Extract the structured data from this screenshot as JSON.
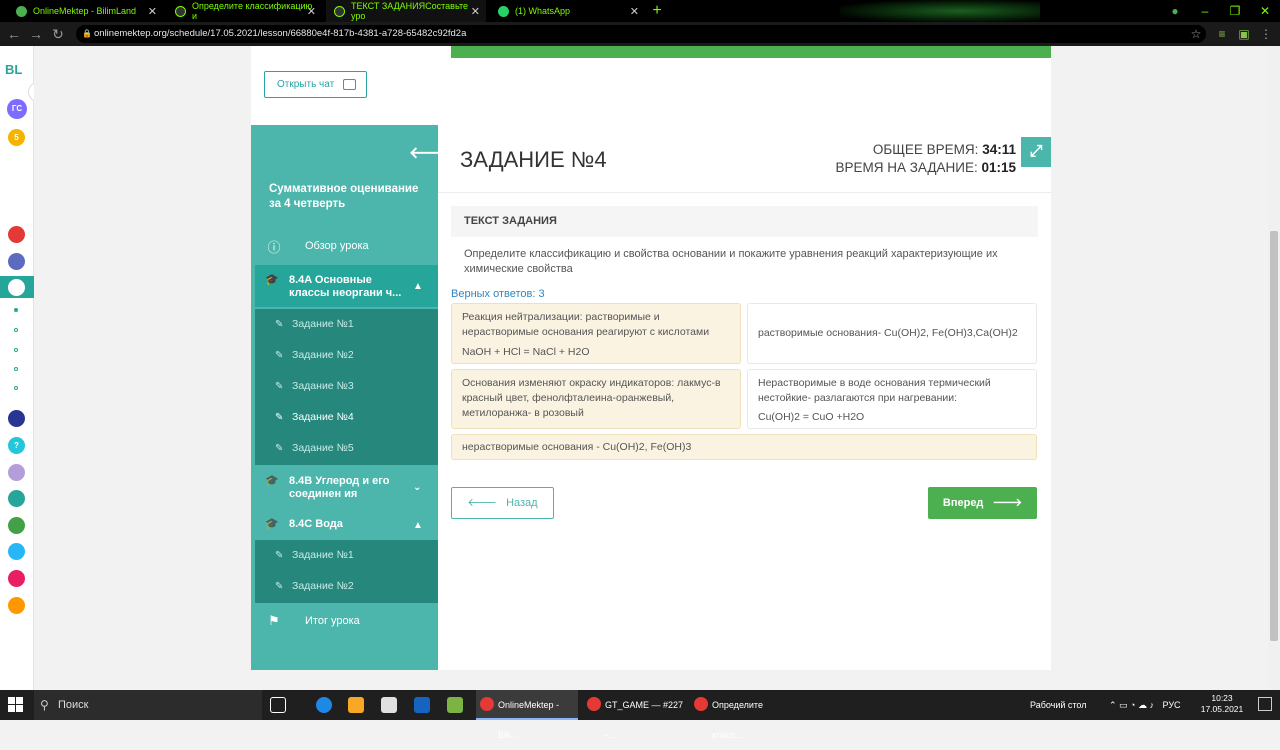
{
  "browser": {
    "tabs": [
      {
        "title": "OnlineMektep - BilimLand",
        "active": false,
        "icon_color": "#4caf50"
      },
      {
        "title": "Определите классификацию и",
        "active": false,
        "icon_color": "#333333"
      },
      {
        "title": "ТЕКСТ ЗАДАНИЯСоставьте уро",
        "active": true,
        "icon_color": "#333333"
      },
      {
        "title": "(1) WhatsApp",
        "active": false,
        "icon_color": "#25d366"
      }
    ],
    "url": "onlinemektep.org/schedule/17.05.2021/lesson/66880e4f-817b-4381-a728-65482c92fd2a"
  },
  "left_rail": {
    "logo": "BL",
    "avatar_initials": "ГС",
    "badge_count": "5"
  },
  "chat_button_label": "Открыть чат",
  "sidebar": {
    "course_title": "Суммативное оценивание за 4 четверть",
    "overview_label": "Обзор урока",
    "modules": [
      {
        "title": "8.4A Основные классы неоргани ч...",
        "expanded": true,
        "tasks": [
          "Задание №1",
          "Задание №2",
          "Задание №3",
          "Задание №4",
          "Задание №5"
        ],
        "current_task_index": 3
      },
      {
        "title": "8.4B Углерод и его соединен ия",
        "expanded": false
      },
      {
        "title": "8.4C Вода",
        "expanded": true,
        "tasks": [
          "Задание №1",
          "Задание №2"
        ]
      }
    ],
    "summary_label": "Итог урока"
  },
  "task": {
    "title": "ЗАДАНИЕ №4",
    "total_time_label": "ОБЩЕЕ ВРЕМЯ:",
    "total_time_value": "34:11",
    "task_time_label": "ВРЕМЯ НА ЗАДАНИЕ:",
    "task_time_value": "01:15",
    "section_header": "ТЕКСТ ЗАДАНИЯ",
    "question": "Определите классификацию и свойства основании и покажите уравнения реакций характеризующие их химические свойства",
    "correct_answers": "Верных ответов: 3",
    "answers": [
      {
        "line1": "Реакция нейтрализации: растворимые и нерастворимые основания реагируют с кислотами",
        "line2": "NaOH + HCl = NaCl + H2O"
      },
      {
        "line1": "растворимые основания- Cu(OH)2, Fe(OH)3,Ca(OH)2",
        "line2": ""
      },
      {
        "line1": "Основания изменяют окраску индикаторов: лакмус-в красный цвет, фенолфталеина-оранжевый, метилоранжа- в розовый",
        "line2": ""
      },
      {
        "line1": "Нерастворимые в воде основания термический нестойкие- разлагаются при нагревании:",
        "line2": "Cu(OH)2 = CuO +H2O"
      },
      {
        "line1": "нерастворимые основания - Cu(OH)2, Fe(OH)3",
        "line2": ""
      }
    ],
    "back_label": "Назад",
    "next_label": "Вперед"
  },
  "taskbar": {
    "search_placeholder": "Поиск",
    "apps": [
      {
        "label": "OnlineMektep - Bili...",
        "active": true
      },
      {
        "label": "GT_GAME — #227 -...",
        "active": false
      },
      {
        "label": "Определите класс...",
        "active": false
      }
    ],
    "desktop_label": "Рабочий стол",
    "language": "РУС",
    "time": "10:23",
    "date": "17.05.2021"
  },
  "colors": {
    "teal": "#4db6ac",
    "teal_dark": "#26877c",
    "green": "#4caf50",
    "answer_yellow": "#fbf3e2"
  }
}
